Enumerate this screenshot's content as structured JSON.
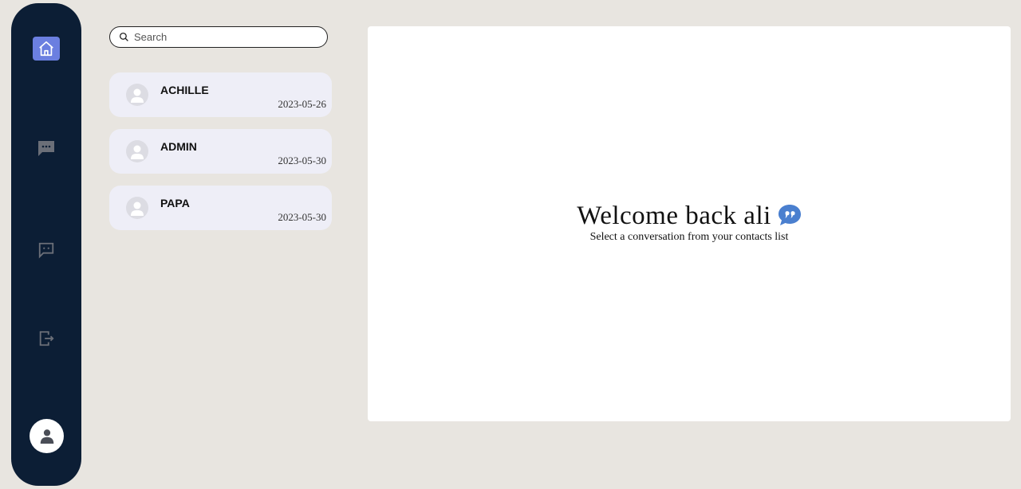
{
  "colors": {
    "sidebar": "#0c1e35",
    "active_nav": "#6b7fe0",
    "page_bg": "#e8e5e0",
    "contact_bg": "#eeeef7",
    "quote_icon": "#4a7fcf"
  },
  "sidebar": {
    "items": [
      {
        "icon": "home-icon",
        "active": true
      },
      {
        "icon": "chat-bubble-dots-icon",
        "active": false
      },
      {
        "icon": "message-square-icon",
        "active": false
      },
      {
        "icon": "logout-icon",
        "active": false
      }
    ],
    "profile_icon": "user-icon"
  },
  "search": {
    "placeholder": "Search",
    "value": ""
  },
  "contacts": [
    {
      "name": "ACHILLE",
      "date": "2023-05-26"
    },
    {
      "name": "ADMIN",
      "date": "2023-05-30"
    },
    {
      "name": "PAPA",
      "date": "2023-05-30"
    }
  ],
  "main": {
    "welcome_title": "Welcome back ali",
    "welcome_subtitle": "Select a conversation from your contacts list",
    "welcome_icon": "quote-bubble-icon"
  }
}
